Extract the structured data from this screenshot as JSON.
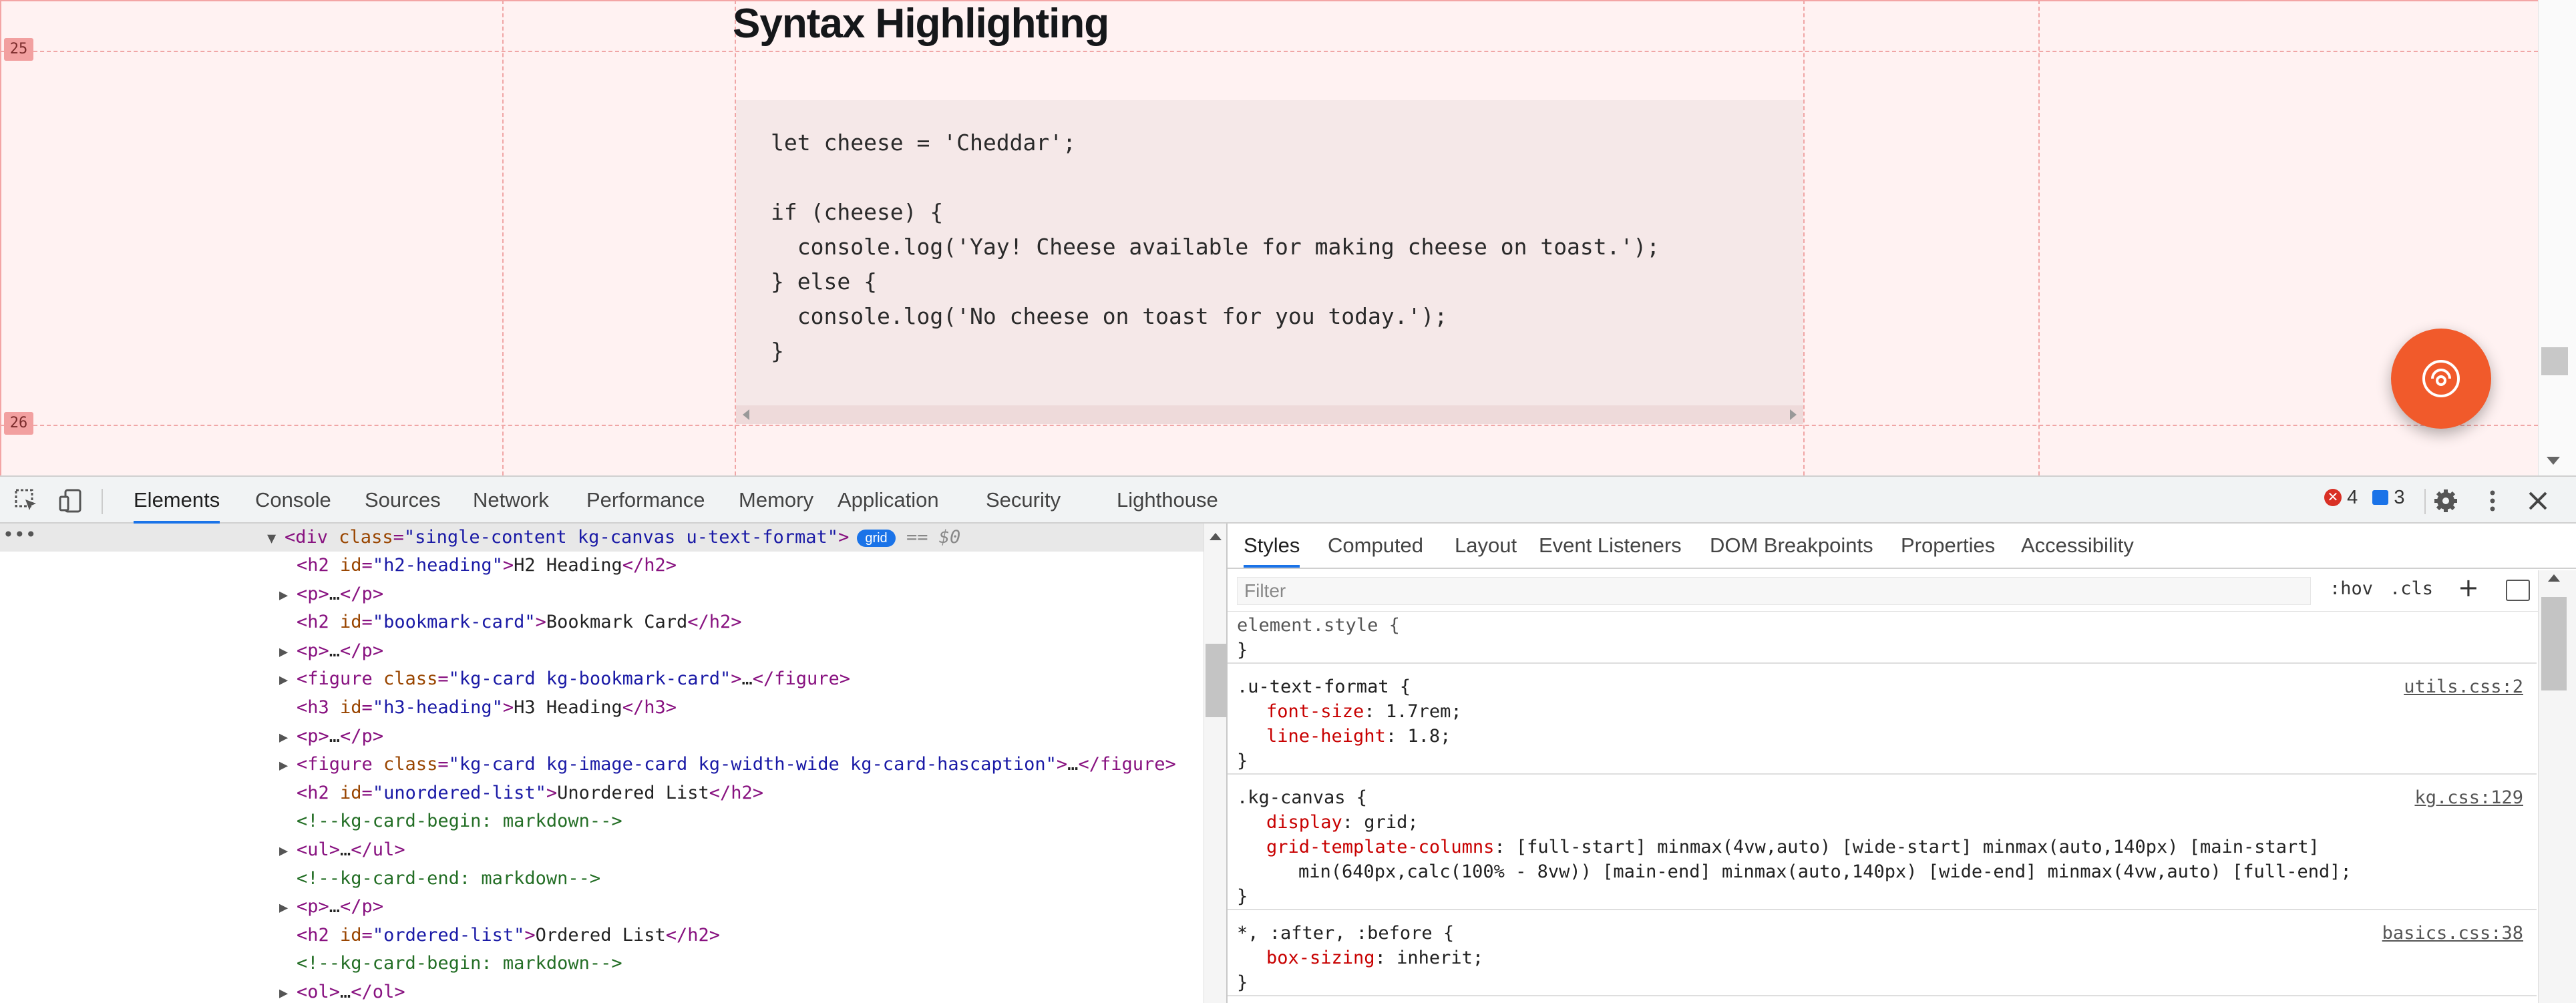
{
  "page": {
    "heading": "Syntax Highlighting",
    "row_labels": [
      "25",
      "26"
    ],
    "code_lines": [
      "let cheese = 'Cheddar';",
      "",
      "if (cheese) {",
      "  console.log('Yay! Cheese available for making cheese on toast.');",
      "} else {",
      "  console.log('No cheese on toast for you today.');",
      "}"
    ],
    "fab_icon": "portal-chat-icon",
    "brand_color": "#f15a2b",
    "grid_overlay_color": "#f0a6a6"
  },
  "devtools": {
    "tabs": [
      "Elements",
      "Console",
      "Sources",
      "Network",
      "Performance",
      "Memory",
      "Application",
      "Security",
      "Lighthouse"
    ],
    "active_tab": "Elements",
    "issues": {
      "errors": "4",
      "messages": "3"
    },
    "toolbar_icons": [
      "inspect-element-icon",
      "device-toolbar-icon",
      "settings-gear-icon",
      "more-menu-icon",
      "close-icon"
    ],
    "accent_color": "#1a73e8"
  },
  "dom": {
    "left_dots": "•••",
    "selected": {
      "tag_open": "<div",
      "attr_name": "class",
      "attr_value": "\"single-content kg-canvas u-text-format\"",
      "tag_close": ">",
      "badge": "grid",
      "eq": "== $0"
    },
    "lines": [
      {
        "arrow": "",
        "parts": [
          [
            "tg",
            "<h2 "
          ],
          [
            "an",
            "id"
          ],
          [
            "tg",
            "="
          ],
          [
            "av",
            "\"h2-heading\""
          ],
          [
            "tg",
            ">"
          ],
          [
            "tx",
            "H2 Heading"
          ],
          [
            "tg",
            "</h2>"
          ]
        ]
      },
      {
        "arrow": "▶",
        "parts": [
          [
            "tg",
            "<p>"
          ],
          [
            "tx",
            "…"
          ],
          [
            "tg",
            "</p>"
          ]
        ]
      },
      {
        "arrow": "",
        "parts": [
          [
            "tg",
            "<h2 "
          ],
          [
            "an",
            "id"
          ],
          [
            "tg",
            "="
          ],
          [
            "av",
            "\"bookmark-card\""
          ],
          [
            "tg",
            ">"
          ],
          [
            "tx",
            "Bookmark Card"
          ],
          [
            "tg",
            "</h2>"
          ]
        ]
      },
      {
        "arrow": "▶",
        "parts": [
          [
            "tg",
            "<p>"
          ],
          [
            "tx",
            "…"
          ],
          [
            "tg",
            "</p>"
          ]
        ]
      },
      {
        "arrow": "▶",
        "parts": [
          [
            "tg",
            "<figure "
          ],
          [
            "an",
            "class"
          ],
          [
            "tg",
            "="
          ],
          [
            "av",
            "\"kg-card kg-bookmark-card\""
          ],
          [
            "tg",
            ">"
          ],
          [
            "tx",
            "…"
          ],
          [
            "tg",
            "</figure>"
          ]
        ]
      },
      {
        "arrow": "",
        "parts": [
          [
            "tg",
            "<h3 "
          ],
          [
            "an",
            "id"
          ],
          [
            "tg",
            "="
          ],
          [
            "av",
            "\"h3-heading\""
          ],
          [
            "tg",
            ">"
          ],
          [
            "tx",
            "H3 Heading"
          ],
          [
            "tg",
            "</h3>"
          ]
        ]
      },
      {
        "arrow": "▶",
        "parts": [
          [
            "tg",
            "<p>"
          ],
          [
            "tx",
            "…"
          ],
          [
            "tg",
            "</p>"
          ]
        ]
      },
      {
        "arrow": "▶",
        "parts": [
          [
            "tg",
            "<figure "
          ],
          [
            "an",
            "class"
          ],
          [
            "tg",
            "="
          ],
          [
            "av",
            "\"kg-card kg-image-card kg-width-wide kg-card-hascaption\""
          ],
          [
            "tg",
            ">"
          ],
          [
            "tx",
            "…"
          ],
          [
            "tg",
            "</figure>"
          ]
        ]
      },
      {
        "arrow": "",
        "parts": [
          [
            "tg",
            "<h2 "
          ],
          [
            "an",
            "id"
          ],
          [
            "tg",
            "="
          ],
          [
            "av",
            "\"unordered-list\""
          ],
          [
            "tg",
            ">"
          ],
          [
            "tx",
            "Unordered List"
          ],
          [
            "tg",
            "</h2>"
          ]
        ]
      },
      {
        "arrow": "",
        "parts": [
          [
            "cm",
            "<!--kg-card-begin: markdown-->"
          ]
        ]
      },
      {
        "arrow": "▶",
        "parts": [
          [
            "tg",
            "<ul>"
          ],
          [
            "tx",
            "…"
          ],
          [
            "tg",
            "</ul>"
          ]
        ]
      },
      {
        "arrow": "",
        "parts": [
          [
            "cm",
            "<!--kg-card-end: markdown-->"
          ]
        ]
      },
      {
        "arrow": "▶",
        "parts": [
          [
            "tg",
            "<p>"
          ],
          [
            "tx",
            "…"
          ],
          [
            "tg",
            "</p>"
          ]
        ]
      },
      {
        "arrow": "",
        "parts": [
          [
            "tg",
            "<h2 "
          ],
          [
            "an",
            "id"
          ],
          [
            "tg",
            "="
          ],
          [
            "av",
            "\"ordered-list\""
          ],
          [
            "tg",
            ">"
          ],
          [
            "tx",
            "Ordered List"
          ],
          [
            "tg",
            "</h2>"
          ]
        ]
      },
      {
        "arrow": "",
        "parts": [
          [
            "cm",
            "<!--kg-card-begin: markdown-->"
          ]
        ]
      },
      {
        "arrow": "▶",
        "parts": [
          [
            "tg",
            "<ol>"
          ],
          [
            "tx",
            "…"
          ],
          [
            "tg",
            "</ol>"
          ]
        ]
      }
    ]
  },
  "styles": {
    "tabs": [
      "Styles",
      "Computed",
      "Layout",
      "Event Listeners",
      "DOM Breakpoints",
      "Properties",
      "Accessibility"
    ],
    "active_tab": "Styles",
    "filter_placeholder": "Filter",
    "hov": ":hov",
    "cls": ".cls",
    "plus": "+",
    "rules": [
      {
        "selector": "element.style {",
        "source": "",
        "decls": [],
        "close": "}"
      },
      {
        "selector": ".u-text-format {",
        "source": "utils.css:2",
        "decls": [
          {
            "prop": "font-size",
            "value": "1.7rem;"
          },
          {
            "prop": "line-height",
            "value": "1.8;"
          }
        ],
        "close": "}"
      },
      {
        "selector": ".kg-canvas {",
        "source": "kg.css:129",
        "decls": [
          {
            "prop": "display",
            "value": "grid;"
          },
          {
            "prop": "grid-template-columns",
            "value": "[full-start] minmax(4vw,auto) [wide-start] minmax(auto,140px) [main-start]",
            "cont": "min(640px,calc(100% - 8vw)) [main-end] minmax(auto,140px) [wide-end] minmax(4vw,auto) [full-end];"
          }
        ],
        "close": "}"
      },
      {
        "selector": "*, :after, :before {",
        "source": "basics.css:38",
        "decls": [
          {
            "prop": "box-sizing",
            "value": "inherit;"
          }
        ],
        "close": "}"
      }
    ]
  }
}
